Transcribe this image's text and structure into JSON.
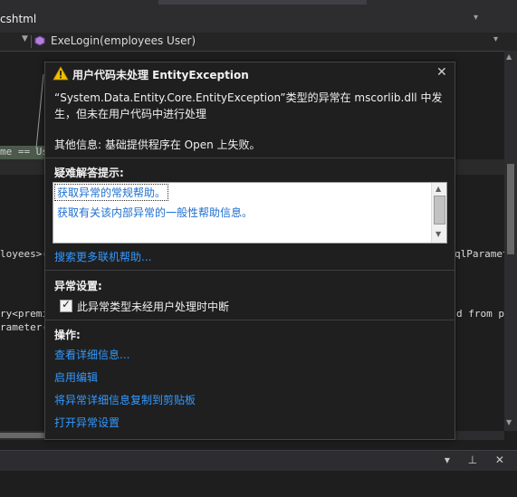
{
  "editor": {
    "file_tab": "cshtml",
    "method_name": "ExeLogin(employees User)",
    "code_lines": {
      "highlight": "me == Us",
      "line_employees": "loyees>(",
      "line_employees_right": "qlParamet",
      "line_premi": "ry<premi",
      "line_premi_right": "d from p",
      "line_parameter": "rameter(\""
    }
  },
  "exception": {
    "title": "用户代码未处理 EntityException",
    "message": "“System.Data.Entity.Core.EntityException”类型的异常在 mscorlib.dll 中发生，但未在用户代码中进行处理",
    "additional_info": "其他信息: 基础提供程序在 Open 上失败。",
    "tips_header": "疑难解答提示:",
    "tips": [
      "获取异常的常规帮助。",
      "获取有关该内部异常的一般性帮助信息。"
    ],
    "search_more": "搜索更多联机帮助...",
    "settings_header": "异常设置:",
    "break_checkbox_label": "此异常类型未经用户处理时中断",
    "break_checked": true,
    "actions_header": "操作:",
    "actions": [
      "查看详细信息...",
      "启用编辑",
      "将异常详细信息复制到剪贴板",
      "打开异常设置"
    ]
  },
  "bottom_tools": "▾ ⊥ ✕",
  "colors": {
    "background": "#1e1e1e",
    "link": "#3399ff",
    "warning": "#f0c000"
  }
}
